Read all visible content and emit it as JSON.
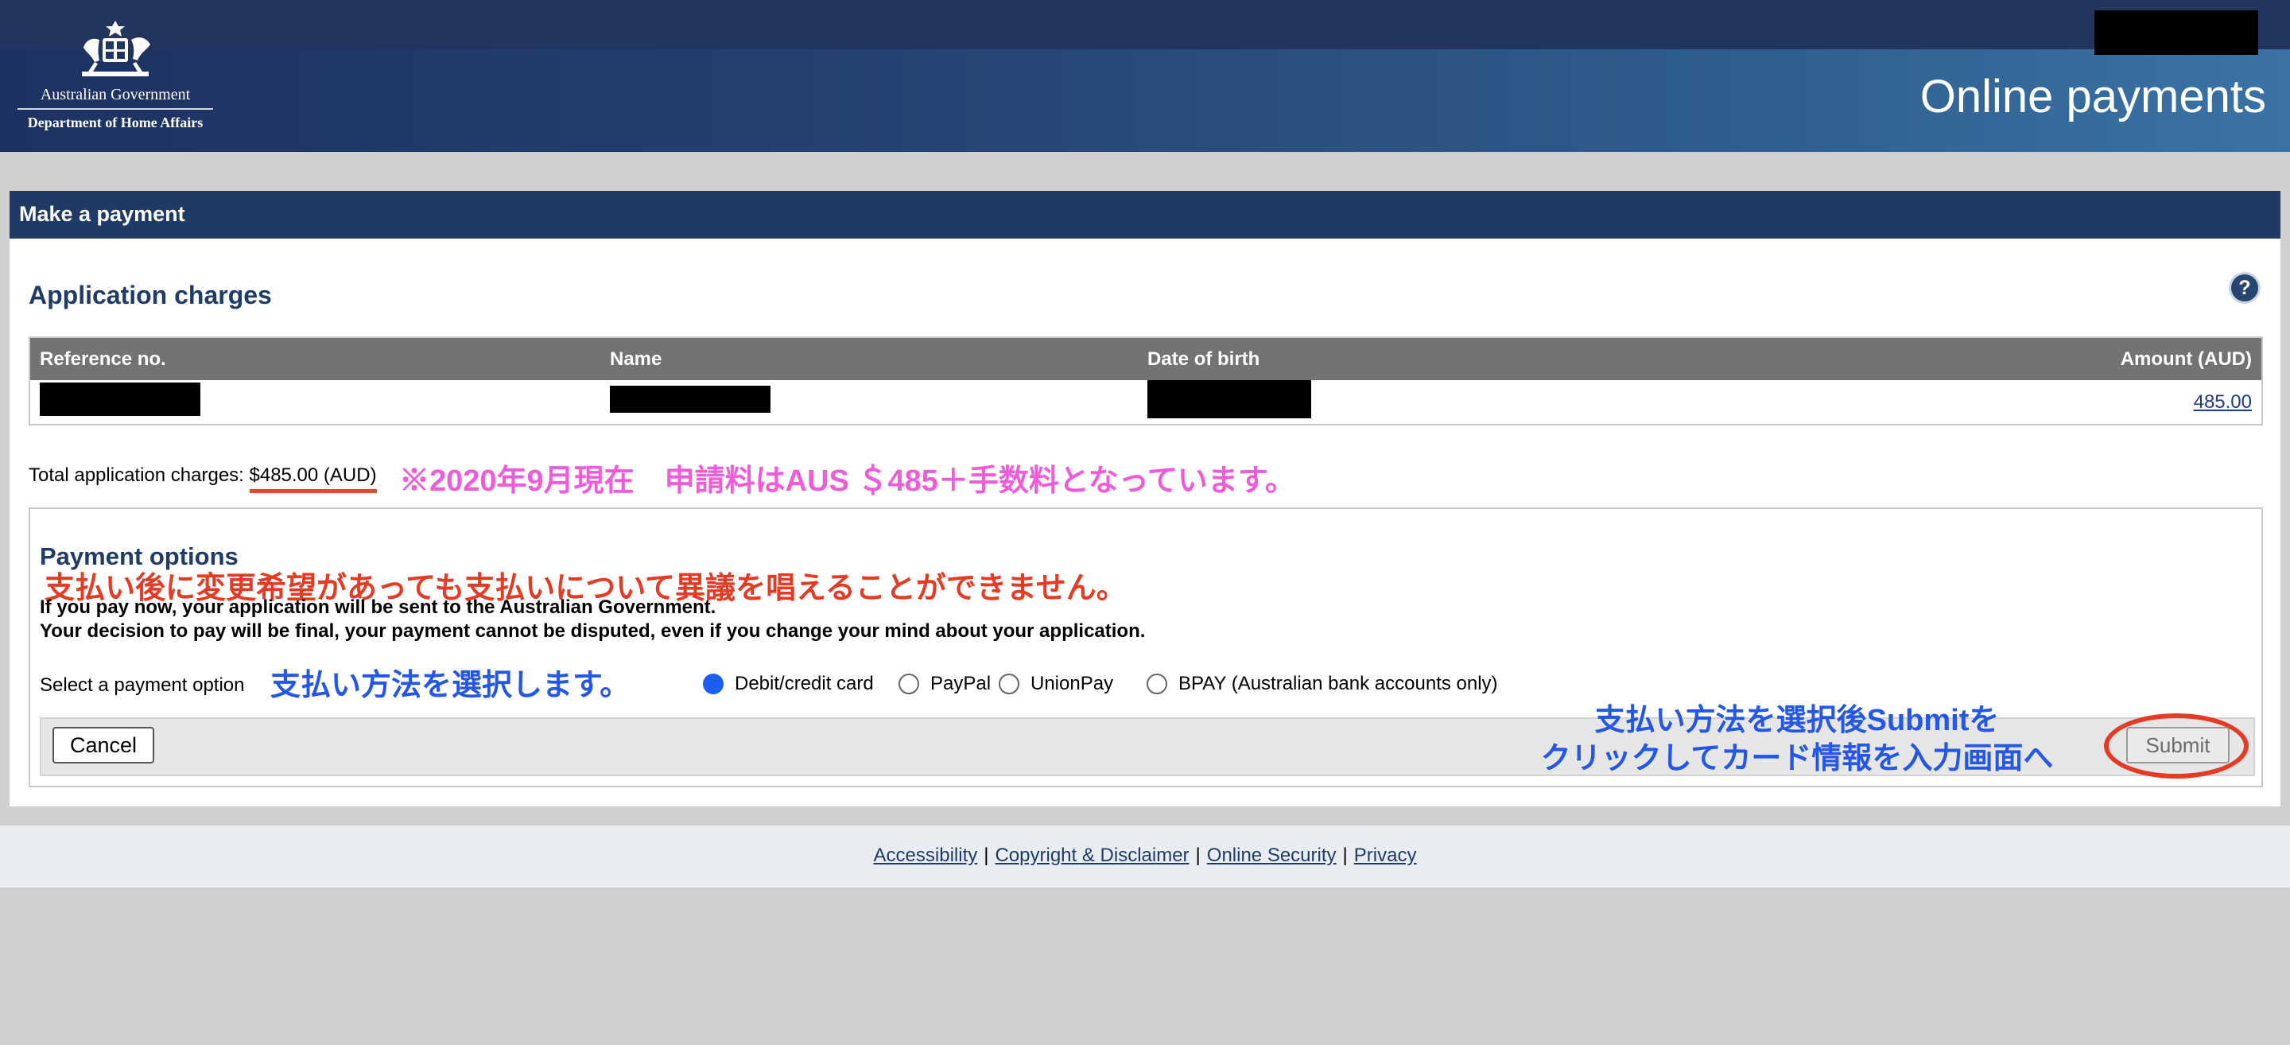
{
  "header": {
    "logo_line1": "Australian Government",
    "logo_line2": "Department of Home Affairs",
    "site_title": "Online payments"
  },
  "panel": {
    "heading": "Make a payment",
    "section_title": "Application charges",
    "help_icon": "?",
    "table": {
      "columns": [
        "Reference no.",
        "Name",
        "Date of birth",
        "Amount (AUD)"
      ],
      "rows": [
        {
          "amount": "485.00"
        }
      ]
    },
    "total_label": "Total application charges: ",
    "total_value": "$485.00 (AUD)"
  },
  "annotations": {
    "pink_note": "※2020年9月現在　申請料はAUS ＄485＋手数料となっています。",
    "red_note": "支払い後に変更希望があっても支払いについて異議を唱えることができません。",
    "blue_note_select": "支払い方法を選択します。",
    "blue_note_submit_line1": "支払い方法を選択後Submitを",
    "blue_note_submit_line2": "クリックしてカード情報を入力画面へ"
  },
  "payment_options": {
    "title": "Payment options",
    "text1": "If you pay now, your application will be sent to the Australian Government.",
    "text2": "Your decision to pay will be final, your payment cannot be disputed, even if you change your mind about your application.",
    "select_label": "Select a payment option",
    "options": [
      {
        "label": "Debit/credit card",
        "selected": true
      },
      {
        "label": "PayPal",
        "selected": false
      },
      {
        "label": "UnionPay",
        "selected": false
      },
      {
        "label": "BPAY (Australian bank accounts only)",
        "selected": false
      }
    ],
    "cancel_label": "Cancel",
    "submit_label": "Submit"
  },
  "footer": {
    "links": [
      "Accessibility",
      "Copyright & Disclaimer",
      "Online Security",
      "Privacy"
    ],
    "separator": "|"
  },
  "colors": {
    "header_dark": "#21355f",
    "panel_head": "#203a66",
    "title_blue": "#1f3b66",
    "annotation_pink": "#ef5bd8",
    "annotation_red": "#e53b25",
    "annotation_blue": "#2457e8",
    "radio_selected": "#1b5ef0"
  }
}
